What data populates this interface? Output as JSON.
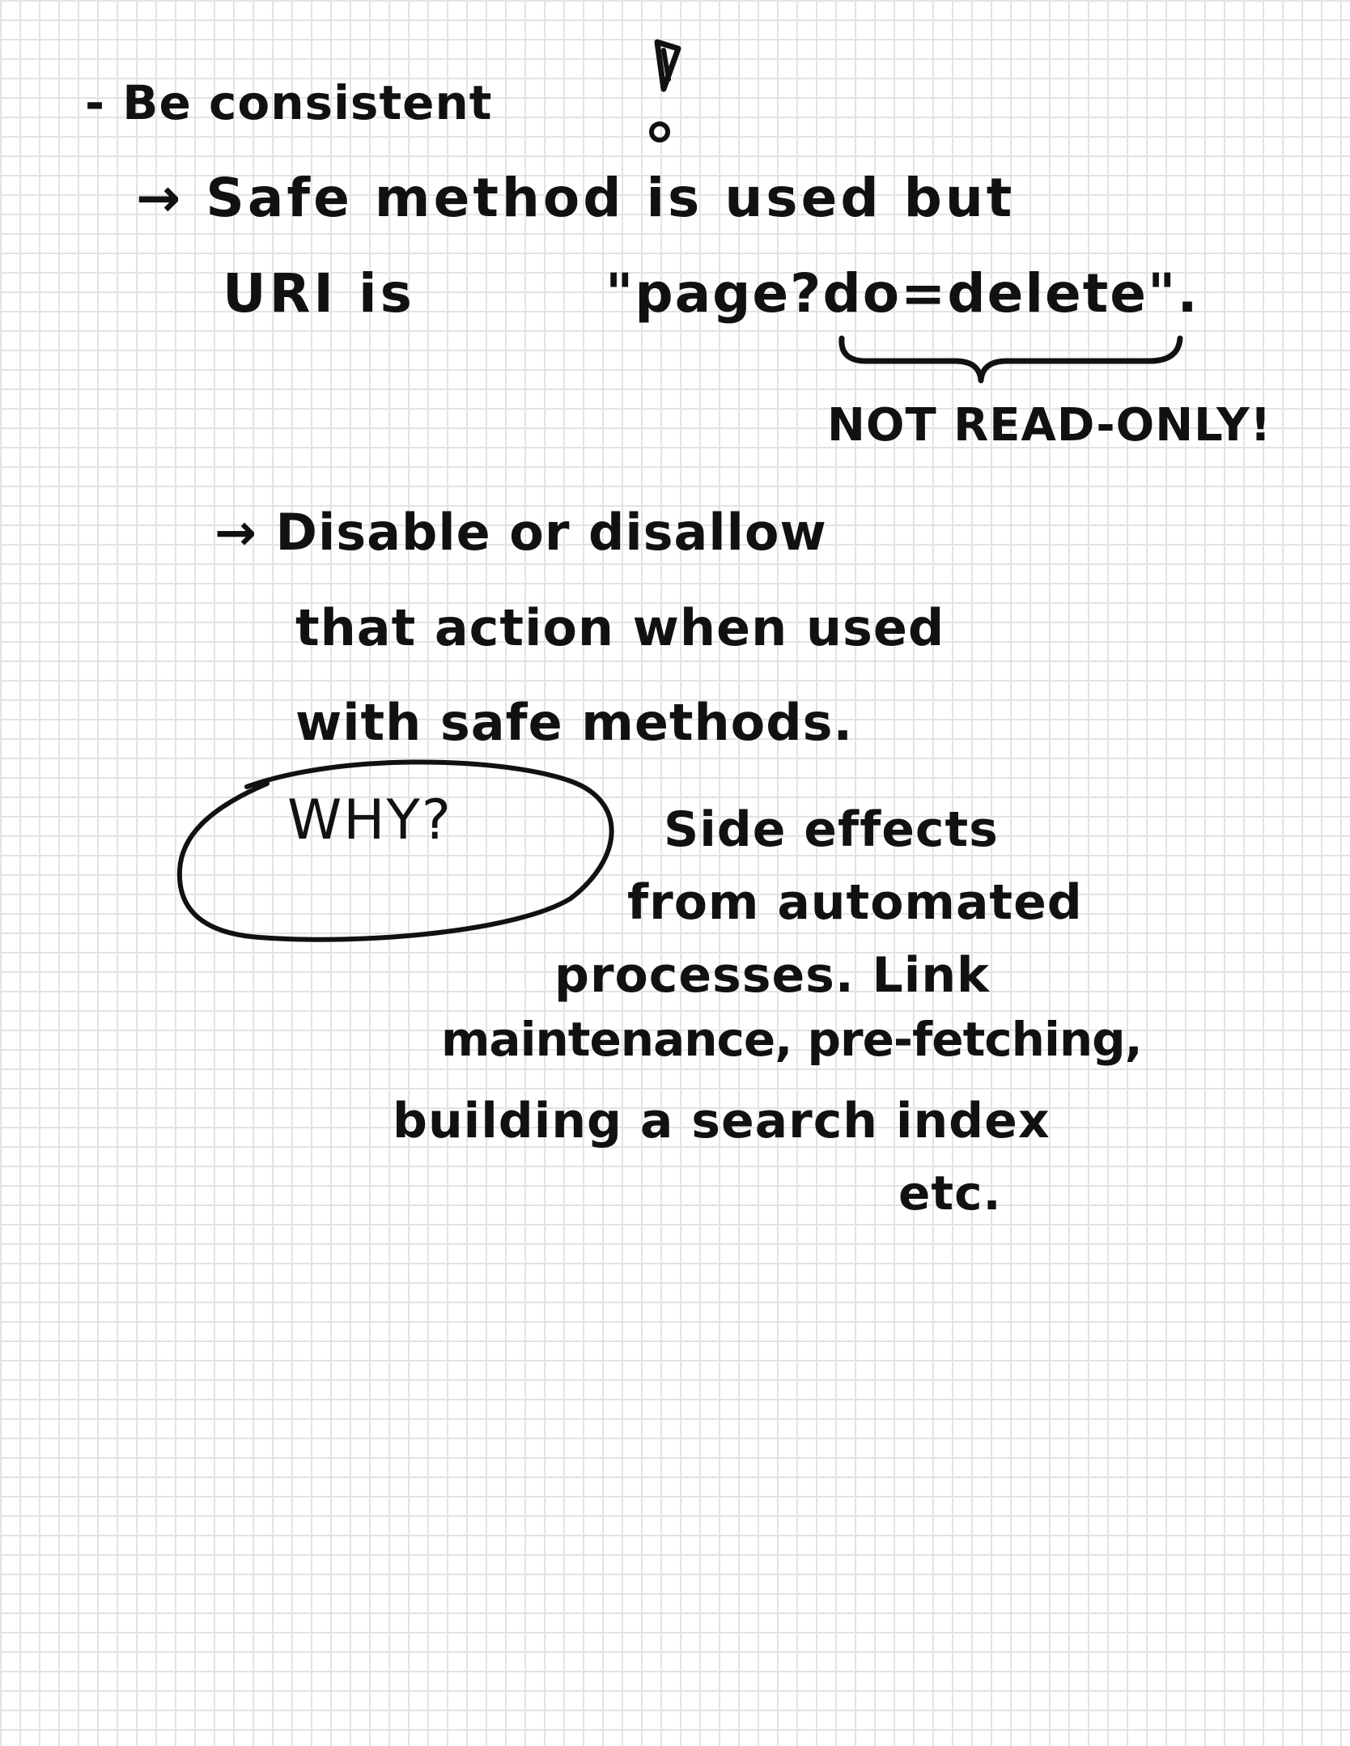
{
  "notes": {
    "line1": "- Be consistent",
    "line2": "→ Safe method is used but",
    "line3_prefix": "URI is",
    "line3_uri": "\"page?do=delete\".",
    "annotation": "NOT READ-ONLY!",
    "line5": "→ Disable or disallow",
    "line6": "that action when used",
    "line7": "with safe methods.",
    "why": "WHY?",
    "line9": "Side effects",
    "line10": "from automated",
    "line11": "processes. Link",
    "line12": "maintenance, pre-fetching,",
    "line13": "building a search index",
    "line14": "etc."
  },
  "colors": {
    "ink": "#111111",
    "grid": "#e3e3e3",
    "paper": "#ffffff"
  },
  "icons": {
    "warning": "warning-icon",
    "brace": "underbrace",
    "circle": "hand-drawn-circle"
  }
}
